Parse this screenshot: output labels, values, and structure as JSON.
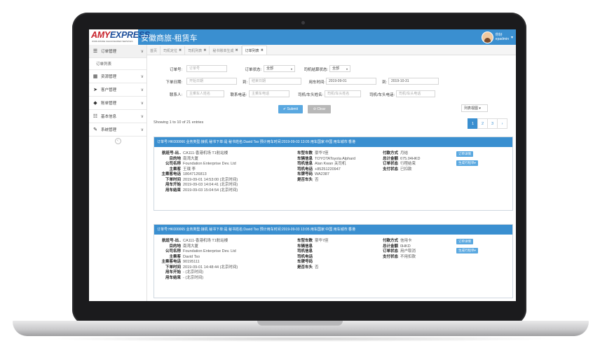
{
  "app": {
    "logo_text_1": "AMY",
    "logo_text_2": "EXPRESS",
    "logo_sub": "WORLDWIDE CHAUFFEURED SERVICES",
    "title": "安徽商旅-租赁车",
    "user_greeting": "你好",
    "user_name": "epadmin"
  },
  "sidebar": {
    "items": [
      {
        "label": "订单管理",
        "icon": "list-icon",
        "chev": "∨"
      },
      {
        "label": "订单列表",
        "sub": true
      },
      {
        "label": "资源管理",
        "icon": "database-icon",
        "chev": "∨"
      },
      {
        "label": "客户管理",
        "icon": "send-icon",
        "chev": "∨"
      },
      {
        "label": "账单管理",
        "icon": "tag-icon",
        "chev": "∨"
      },
      {
        "label": "基本信息",
        "icon": "sliders-icon",
        "chev": "∨"
      },
      {
        "label": "系统管理",
        "icon": "wrench-icon",
        "chev": "∨"
      }
    ],
    "collapse": "‹"
  },
  "tabs": [
    {
      "label": "首页",
      "close": ""
    },
    {
      "label": "司机定位",
      "close": "✖"
    },
    {
      "label": "司机列表",
      "close": "✖"
    },
    {
      "label": "秘书账单生成",
      "close": "✖"
    },
    {
      "label": "订单列表",
      "close": "✖",
      "active": true
    }
  ],
  "form": {
    "order_no_label": "订单号:",
    "order_no_placeholder": "订单号",
    "order_status_label": "订单状态:",
    "order_status_value": "全部",
    "driver_settle_label": "司机结算状态:",
    "driver_settle_value": "全部",
    "order_date_label": "下单日期:",
    "start_date_placeholder": "开始日期",
    "to_label": "到:",
    "end_date_placeholder": "结束日期",
    "use_time_label": "用车时间:",
    "use_time_from": "2019-09-01",
    "to_label_2": "到:",
    "use_time_to": "2019-10-31",
    "contact_label": "联系人:",
    "contact_placeholder": "主乘车人姓名",
    "contact_phone_label": "联系电话:",
    "contact_phone_placeholder": "主乘车电话",
    "driver_name_label": "司机/车头姓名:",
    "driver_name_placeholder": "司机/车头姓名",
    "driver_phone_label": "司机/车头电话:",
    "driver_phone_placeholder": "司机/车头电话",
    "submit": "✔ Submit",
    "clear": "⊘ Clear",
    "view_select": "列表视图"
  },
  "showing": "Showing 1 to 10 of 21 entries",
  "pager": [
    "1",
    "2",
    "3",
    "›"
  ],
  "orders": [
    {
      "header": "订单号:HK000066  业务类型:接机  秘书下单:是  秘书姓名:David Tso  预计用车时间:2019-09-03 13:05  用车国家:中国  用车城市:香港",
      "left": [
        [
          "航班号-出..",
          "CA111-香港机场 T1航站楼"
        ],
        [
          "目的地",
          "南湾大厦"
        ],
        [
          "公司名称",
          "Foundation Enterprise Dev. Ltd"
        ],
        [
          "主乘客",
          "王璞 李"
        ],
        [
          "主乘客电话",
          "18647126813"
        ],
        [
          "下单时间",
          "2019-09-01 14:53:00 (北京时间)"
        ],
        [
          "用车开始",
          "2019-09-03 14:04:41 (北京时间)"
        ],
        [
          "用车结束",
          "2019-09-03 15:04:54 (北京时间)"
        ]
      ],
      "mid": [
        [
          "车型车数",
          "豪华7座"
        ],
        [
          "车辆信息",
          "TOYOTAToyota Alphard"
        ],
        [
          "司机信息",
          "Alan Kwan 关司机"
        ],
        [
          "司机电话",
          "+85251220947"
        ],
        [
          "车牌号码",
          "WA2387"
        ],
        [
          "是否车头",
          "否"
        ]
      ],
      "right": [
        [
          "付款方式",
          "月结"
        ],
        [
          "总计金额",
          "675.04HKD"
        ],
        [
          "订单状态",
          "行程结束"
        ],
        [
          "支付状态",
          "已扣款"
        ]
      ],
      "btn1": "订单详情",
      "btn2": "生成行程单▾"
    },
    {
      "header": "订单号:HK000065  业务类型:接机  秘书下单:是  秘书姓名:David Tso  预计用车时间:2019-09-03 13:05  用车国家:中国  用车城市:香港",
      "left": [
        [
          "航班号-出..",
          "CA111-香港机场 T1航站楼"
        ],
        [
          "目的地",
          "南湾大厦"
        ],
        [
          "公司名称",
          "Foundation Enterprise Dev. Ltd"
        ],
        [
          "主乘客",
          "David Tso"
        ],
        [
          "主乘客电话",
          "90195111"
        ],
        [
          "下单时间",
          "2019-09-01 14:48:44 (北京时间)"
        ],
        [
          "用车开始",
          "- (北京时间)"
        ],
        [
          "用车结束",
          "- (北京时间)"
        ]
      ],
      "mid": [
        [
          "车型车数",
          "豪华7座"
        ],
        [
          "车辆信息",
          ""
        ],
        [
          "司机信息",
          ""
        ],
        [
          "司机电话",
          ""
        ],
        [
          "车牌号码",
          ""
        ],
        [
          "是否车头",
          "否"
        ]
      ],
      "right": [
        [
          "付款方式",
          "信用卡"
        ],
        [
          "总计金额",
          "0HKD"
        ],
        [
          "订单状态",
          "用户取消"
        ],
        [
          "支付状态",
          "不用扣款"
        ]
      ],
      "btn1": "订单详情",
      "btn2": "生成行程单▾"
    }
  ]
}
